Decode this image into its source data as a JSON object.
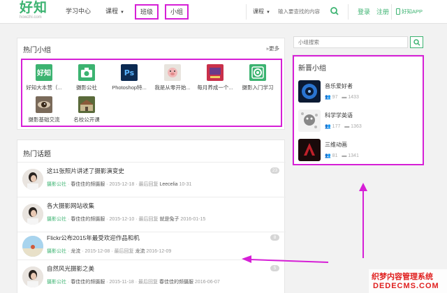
{
  "header": {
    "logo": "好知",
    "logo_sub": "howzhi.com",
    "nav": {
      "learning_center": "学习中心",
      "courses": "课程",
      "classes": "班级",
      "groups": "小组"
    },
    "search": {
      "category": "课程",
      "placeholder": "输入要查找的内容"
    },
    "login": "登录",
    "register": "注册",
    "app": "好知APP"
  },
  "hot_groups": {
    "title": "热门小组",
    "more": "»更多",
    "items": [
      {
        "label": "好知大本营（...",
        "icon": "howzhi-logo-icon"
      },
      {
        "label": "摄影公社",
        "icon": "camera-icon"
      },
      {
        "label": "Photoshop特...",
        "icon": "photoshop-icon"
      },
      {
        "label": "我是从零开始...",
        "icon": "pig-icon"
      },
      {
        "label": "每月养成一个...",
        "icon": "book-icon"
      },
      {
        "label": "摄影入门学习",
        "icon": "camera-lens-icon"
      },
      {
        "label": "摄影基础交流",
        "icon": "eye-icon"
      },
      {
        "label": "名校公开课",
        "icon": "school-icon"
      }
    ]
  },
  "topics": {
    "title": "热门话题",
    "items": [
      {
        "title": "这11张照片讲述了摄影演变史",
        "group": "摄影公社",
        "author": "春佳佳的频摄服",
        "date": "2015-12-18",
        "last_label": "最后回复",
        "last_user": "Leecelia",
        "last_date": "10-31",
        "replies": "23"
      },
      {
        "title": "各大摄影网站收集",
        "group": "摄影公社",
        "author": "春佳佳的频摄服",
        "date": "2015-12-10",
        "last_label": "最后回复",
        "last_user": "就是兔子",
        "last_date": "2016-01-15",
        "replies": ""
      },
      {
        "title": "Flickr公布2015年最受欢迎作品和机",
        "group": "摄影公社",
        "author": "龙流",
        "date": "2015-12-08",
        "last_label": "最后回复",
        "last_user": "龙流",
        "last_date": "2016-12-09",
        "replies": "8"
      },
      {
        "title": "自然风光摄影之美",
        "group": "摄影公社",
        "author": "春佳佳的频摄服",
        "date": "2015-11-18",
        "last_label": "最后回复",
        "last_user": "春佳佳的频摄服",
        "last_date": "2016-06-07",
        "replies": "5"
      }
    ]
  },
  "group_search": {
    "placeholder": "小组搜索"
  },
  "new_groups": {
    "title": "新晋小组",
    "items": [
      {
        "name": "音乐爱好者",
        "members": "97",
        "topics": "1433"
      },
      {
        "name": "科学学英语",
        "members": "177",
        "topics": "1363"
      },
      {
        "name": "三维动画",
        "members": "81",
        "topics": "1341"
      }
    ]
  },
  "watermark": {
    "line1": "织梦内容管理系统",
    "line2": "DEDECMS.COM"
  },
  "colors": {
    "brand": "#3cb371",
    "highlight": "#d61fd6",
    "arrow": "#d61fd6"
  }
}
